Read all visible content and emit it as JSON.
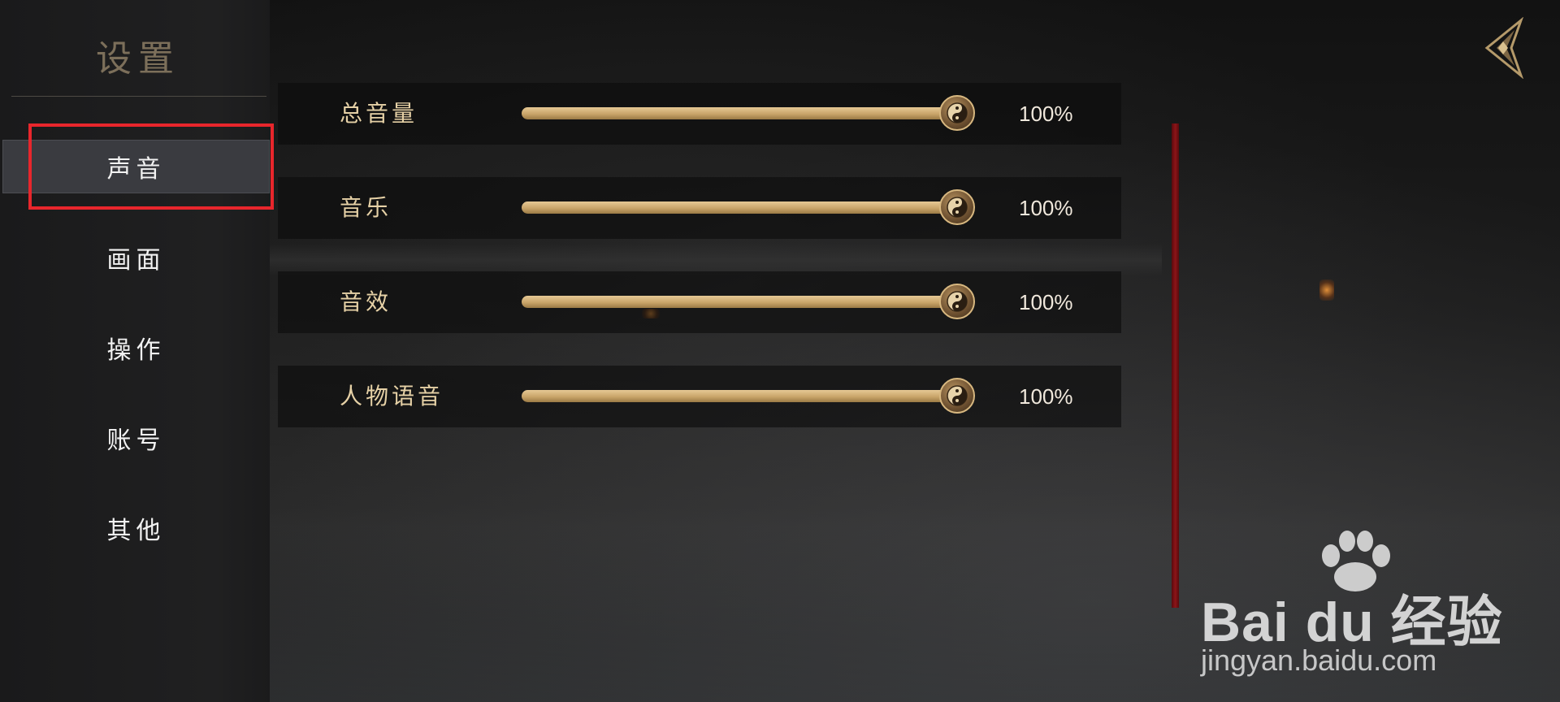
{
  "sidebar": {
    "title": "设置",
    "items": [
      {
        "label": "声音",
        "active": true
      },
      {
        "label": "画面",
        "active": false
      },
      {
        "label": "操作",
        "active": false
      },
      {
        "label": "账号",
        "active": false
      },
      {
        "label": "其他",
        "active": false
      }
    ]
  },
  "settings": [
    {
      "label": "总音量",
      "value": "100%",
      "level": 1.0
    },
    {
      "label": "音乐",
      "value": "100%",
      "level": 1.0
    },
    {
      "label": "音效",
      "value": "100%",
      "level": 1.0
    },
    {
      "label": "人物语音",
      "value": "100%",
      "level": 1.0
    }
  ],
  "icons": {
    "back": "back-arrow-icon",
    "slider_knob": "yin-yang-icon"
  },
  "colors": {
    "accent_gold": "#e6d1a6",
    "highlight_red": "#e8262c",
    "scrollbar_red": "#8c1418"
  },
  "watermark": {
    "logo": "Bai du 经验",
    "url": "jingyan.baidu.com"
  }
}
